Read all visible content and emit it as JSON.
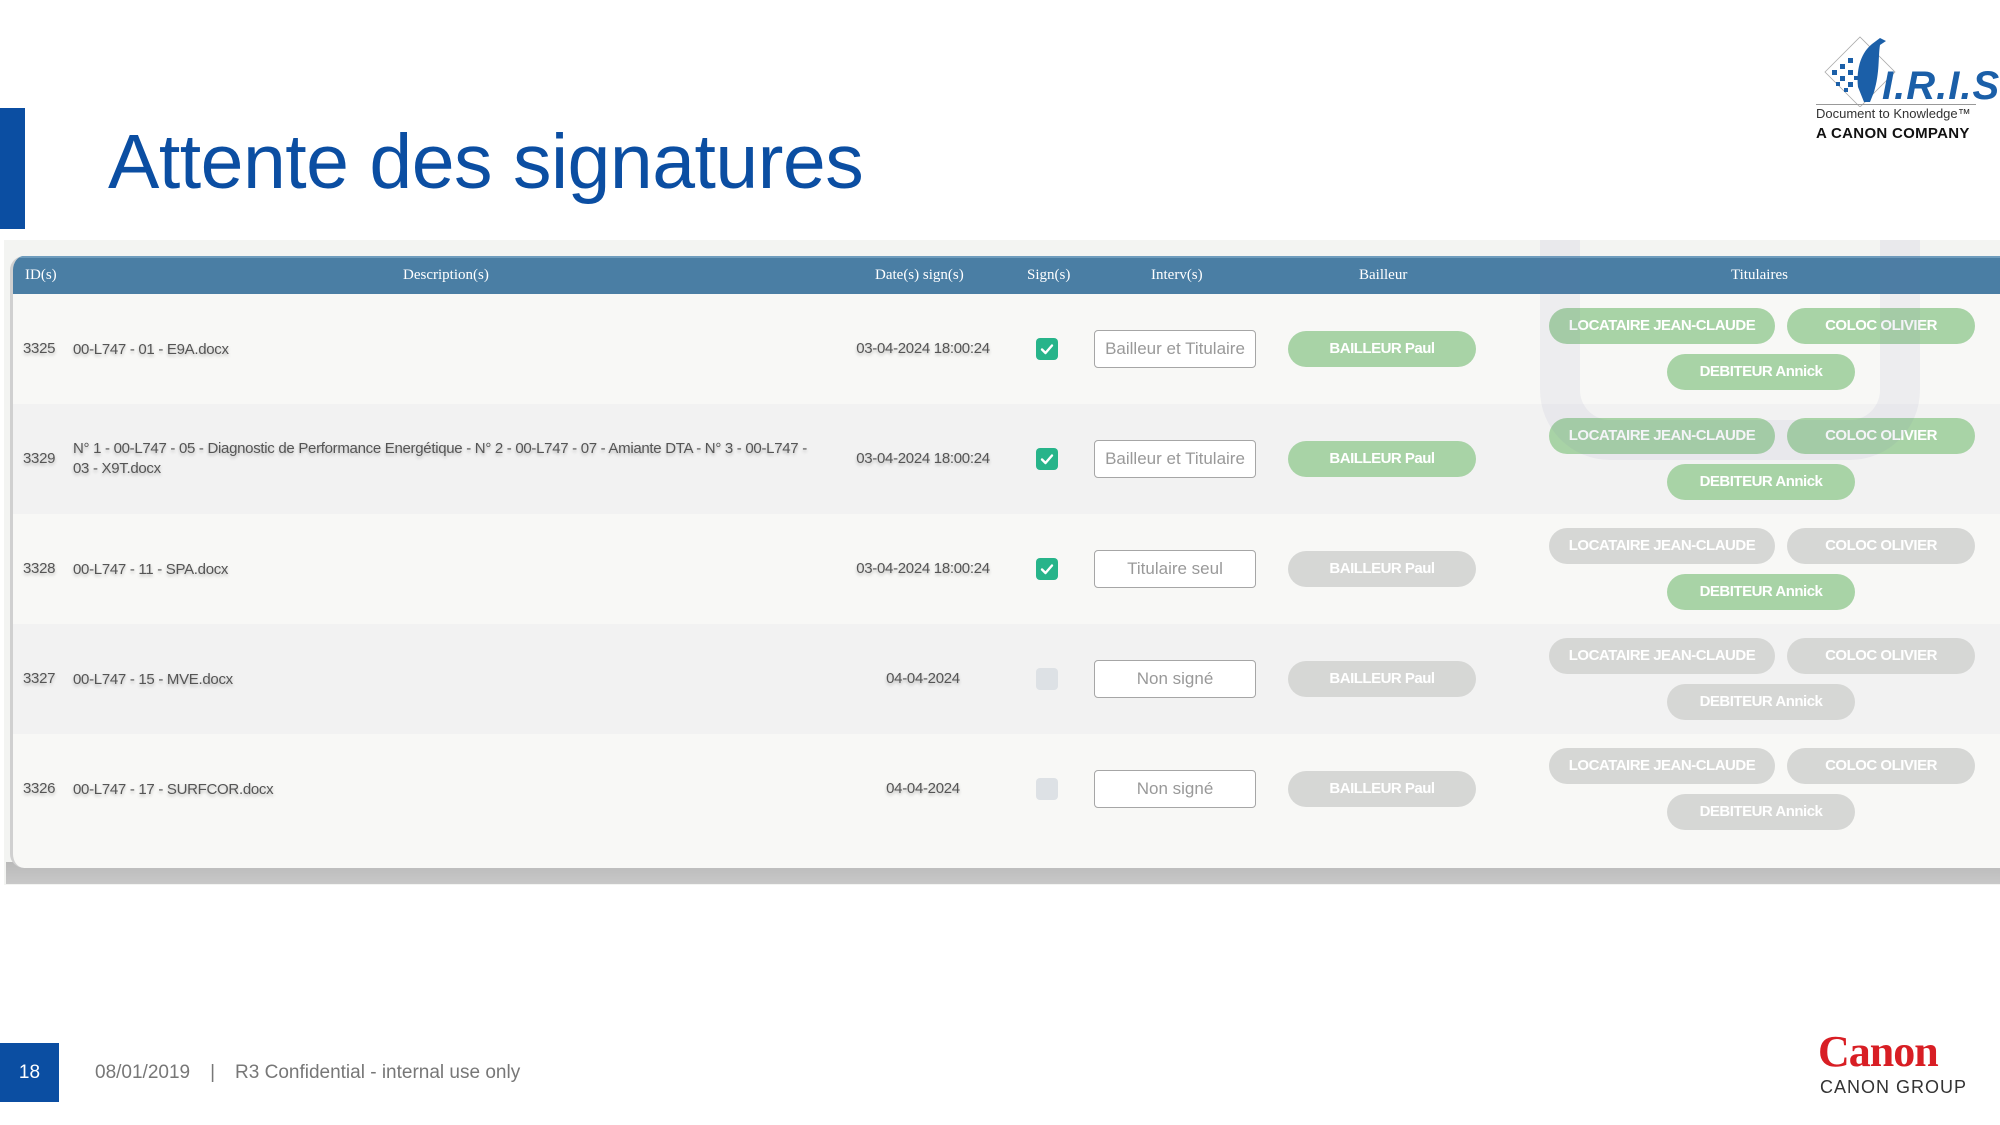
{
  "slide": {
    "title": "Attente des signatures",
    "page_number": "18",
    "footer_date": "08/01/2019",
    "footer_separator": "|",
    "footer_confidential": "R3 Confidential - internal use only"
  },
  "logos": {
    "iris_name": "I.R.I.S.",
    "iris_tagline": "Document to Knowledge™",
    "iris_company": "A CANON COMPANY",
    "canon_word": "Canon",
    "canon_group": "CANON GROUP"
  },
  "colors": {
    "brand_blue": "#0b4ea2",
    "header_blue": "#4a7ea4",
    "signed_green": "#27b48a",
    "pill_green": "#a8d3a6",
    "pill_grey": "#d6d7d5",
    "canon_red": "#d81e24"
  },
  "table": {
    "columns": [
      "ID(s)",
      "Description(s)",
      "Date(s) sign(s)",
      "Sign(s)",
      "Interv(s)",
      "Bailleur",
      "Titulaires"
    ],
    "rows": [
      {
        "id": "3325",
        "description": "00-L747 - 01 - E9A.docx",
        "date": "03-04-2024 18:00:24",
        "signed": true,
        "interv": "Bailleur et Titulaire",
        "bailleur": {
          "label": "BAILLEUR Paul",
          "state": "green"
        },
        "titulaires": [
          {
            "label": "LOCATAIRE JEAN-CLAUDE",
            "state": "green"
          },
          {
            "label": "COLOC OLIVIER",
            "state": "green"
          },
          {
            "label": "DEBITEUR Annick",
            "state": "green"
          }
        ]
      },
      {
        "id": "3329",
        "description": "N° 1 - 00-L747 - 05 - Diagnostic de Performance Energétique - N° 2 - 00-L747 - 07 - Amiante DTA - N° 3 - 00-L747 - 03 - X9T.docx",
        "date": "03-04-2024 18:00:24",
        "signed": true,
        "interv": "Bailleur et Titulaire",
        "bailleur": {
          "label": "BAILLEUR Paul",
          "state": "green"
        },
        "titulaires": [
          {
            "label": "LOCATAIRE JEAN-CLAUDE",
            "state": "green"
          },
          {
            "label": "COLOC OLIVIER",
            "state": "green"
          },
          {
            "label": "DEBITEUR Annick",
            "state": "green"
          }
        ]
      },
      {
        "id": "3328",
        "description": "00-L747 - 11 - SPA.docx",
        "date": "03-04-2024 18:00:24",
        "signed": true,
        "interv": "Titulaire seul",
        "bailleur": {
          "label": "BAILLEUR Paul",
          "state": "grey"
        },
        "titulaires": [
          {
            "label": "LOCATAIRE JEAN-CLAUDE",
            "state": "grey"
          },
          {
            "label": "COLOC OLIVIER",
            "state": "grey"
          },
          {
            "label": "DEBITEUR Annick",
            "state": "green"
          }
        ]
      },
      {
        "id": "3327",
        "description": "00-L747 - 15 - MVE.docx",
        "date": "04-04-2024",
        "signed": false,
        "interv": "Non signé",
        "bailleur": {
          "label": "BAILLEUR Paul",
          "state": "grey"
        },
        "titulaires": [
          {
            "label": "LOCATAIRE JEAN-CLAUDE",
            "state": "grey"
          },
          {
            "label": "COLOC OLIVIER",
            "state": "grey"
          },
          {
            "label": "DEBITEUR Annick",
            "state": "grey"
          }
        ]
      },
      {
        "id": "3326",
        "description": "00-L747 - 17 - SURFCOR.docx",
        "date": "04-04-2024",
        "signed": false,
        "interv": "Non signé",
        "bailleur": {
          "label": "BAILLEUR Paul",
          "state": "grey"
        },
        "titulaires": [
          {
            "label": "LOCATAIRE JEAN-CLAUDE",
            "state": "grey"
          },
          {
            "label": "COLOC OLIVIER",
            "state": "grey"
          },
          {
            "label": "DEBITEUR Annick",
            "state": "grey"
          }
        ]
      }
    ]
  }
}
